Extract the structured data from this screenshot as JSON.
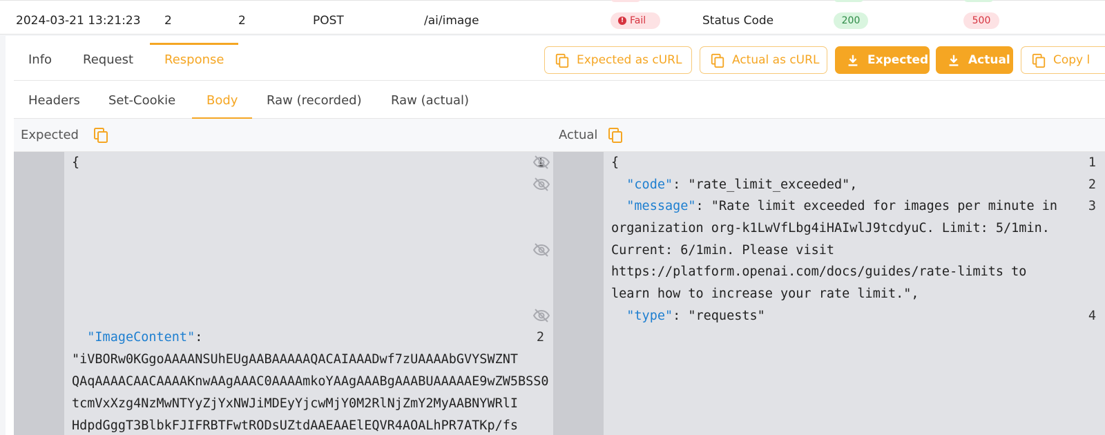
{
  "row": {
    "timestamp": "2024-03-21 13:21:23",
    "col2": "2",
    "col3": "2",
    "method": "POST",
    "path": "/ai/image",
    "result": "Fail",
    "compare_field": "Status Code",
    "expected_status": "200",
    "actual_status": "500"
  },
  "tabs": [
    "Info",
    "Request",
    "Response"
  ],
  "actions": {
    "expected_curl": "Expected as cURL",
    "actual_curl": "Actual as cURL",
    "download_expected": "Expected",
    "download_actual": "Actual",
    "copy": "Copy l"
  },
  "subtabs": [
    "Headers",
    "Set-Cookie",
    "Body",
    "Raw (recorded)",
    "Raw (actual)"
  ],
  "compare": {
    "expected_label": "Expected",
    "actual_label": "Actual"
  },
  "expected_code": {
    "line1_no": "1",
    "line1": "{",
    "line2_no": "2",
    "line2_key": "\"ImageContent\"",
    "line2_colon": ":",
    "wrap": [
      "\"iVBORw0KGgoAAAANSUhEUgAABAAAAAQACAIAAADwf7zUAAAAbGVYSWZNT",
      "QAqAAAACAACAAAAKnwAAgAAAC0AAAAmkoYAAgAAABgAAABUAAAAAE9wZW5BSS0",
      "tcmVxXzg4NzMwNTYyZjYxNWJiMDEyYjcwMjY0M2RlNjZmY2MyAABNYWRlI",
      "HdpdGggT3BlbkFJIFRBTFwtRODsUZtdAAEAAElEQVR4AOALhPR7ATKp/fs"
    ]
  },
  "actual_code": {
    "lines": [
      {
        "no": "1",
        "text": "{"
      },
      {
        "no": "2",
        "key": "\"code\"",
        "rest": ": \"rate_limit_exceeded\","
      },
      {
        "no": "3",
        "key": "\"message\"",
        "rest": ": \"Rate limit exceeded for images per minute in"
      },
      {
        "no": "",
        "text": "organization org-k1LwVfLbg4iHAIwlJ9tcdyuC. Limit: 5/1min."
      },
      {
        "no": "",
        "text": "Current: 6/1min. Please visit"
      },
      {
        "no": "",
        "text": "https://platform.openai.com/docs/guides/rate-limits to"
      },
      {
        "no": "",
        "text": "learn how to increase your rate limit.\","
      },
      {
        "no": "4",
        "key": "\"type\"",
        "rest": ": \"requests\""
      }
    ]
  },
  "colors": {
    "accent": "#f5a623",
    "fail": "#d6333f",
    "success": "#2e8b47",
    "json_key": "#1e7fd0"
  },
  "icons": [
    "fail-icon",
    "copy-icon",
    "download-icon",
    "eye-off-icon"
  ]
}
